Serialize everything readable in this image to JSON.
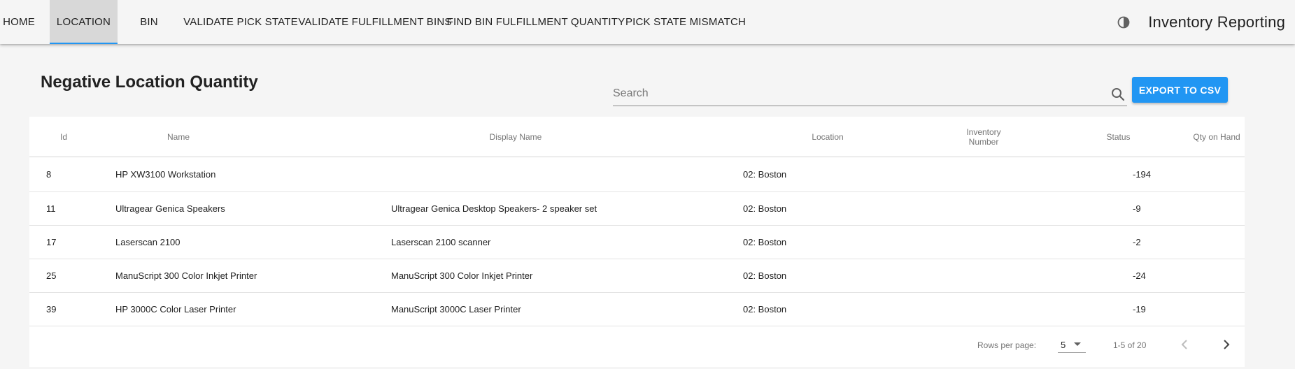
{
  "nav": {
    "tabs": [
      {
        "label": "HOME"
      },
      {
        "label": "LOCATION"
      },
      {
        "label": "BIN"
      },
      {
        "label": "VALIDATE PICK STATE"
      },
      {
        "label": "VALIDATE FULFILLMENT BINS"
      },
      {
        "label": "FIND BIN FULFILLMENT QUANTITY"
      },
      {
        "label": "PICK STATE MISMATCH"
      }
    ],
    "active_tab": "LOCATION",
    "theme_icon": "contrast-icon",
    "app_title": "Inventory Reporting"
  },
  "page": {
    "title": "Negative Location Quantity"
  },
  "search": {
    "placeholder": "Search",
    "value": "",
    "icon": "search-icon"
  },
  "export_button": {
    "label": "EXPORT TO CSV"
  },
  "colors": {
    "accent": "#2196f3",
    "active_tab_bg": "#d8d8d8"
  },
  "table": {
    "columns": [
      "Id",
      "Name",
      "Display Name",
      "Location",
      "Inventory Number",
      "Status",
      "Qty on Hand"
    ],
    "rows": [
      {
        "id": "8",
        "name": "HP XW3100 Workstation",
        "display_name": "",
        "location": "02: Boston",
        "inventory_number": "",
        "status": "",
        "qty": "-194"
      },
      {
        "id": "11",
        "name": "Ultragear Genica Speakers",
        "display_name": "Ultragear Genica Desktop Speakers- 2 speaker set",
        "location": "02: Boston",
        "inventory_number": "",
        "status": "",
        "qty": "-9"
      },
      {
        "id": "17",
        "name": "Laserscan 2100",
        "display_name": "Laserscan 2100 scanner",
        "location": "02: Boston",
        "inventory_number": "",
        "status": "",
        "qty": "-2"
      },
      {
        "id": "25",
        "name": "ManuScript 300 Color Inkjet Printer",
        "display_name": "ManuScript 300 Color Inkjet Printer",
        "location": "02: Boston",
        "inventory_number": "",
        "status": "",
        "qty": "-24"
      },
      {
        "id": "39",
        "name": "HP 3000C Color Laser Printer",
        "display_name": "ManuScript 3000C Laser Printer",
        "location": "02: Boston",
        "inventory_number": "",
        "status": "",
        "qty": "-19"
      }
    ]
  },
  "pagination": {
    "rows_per_page_label": "Rows per page:",
    "rows_per_page_value": "5",
    "range_text": "1-5 of 20"
  }
}
